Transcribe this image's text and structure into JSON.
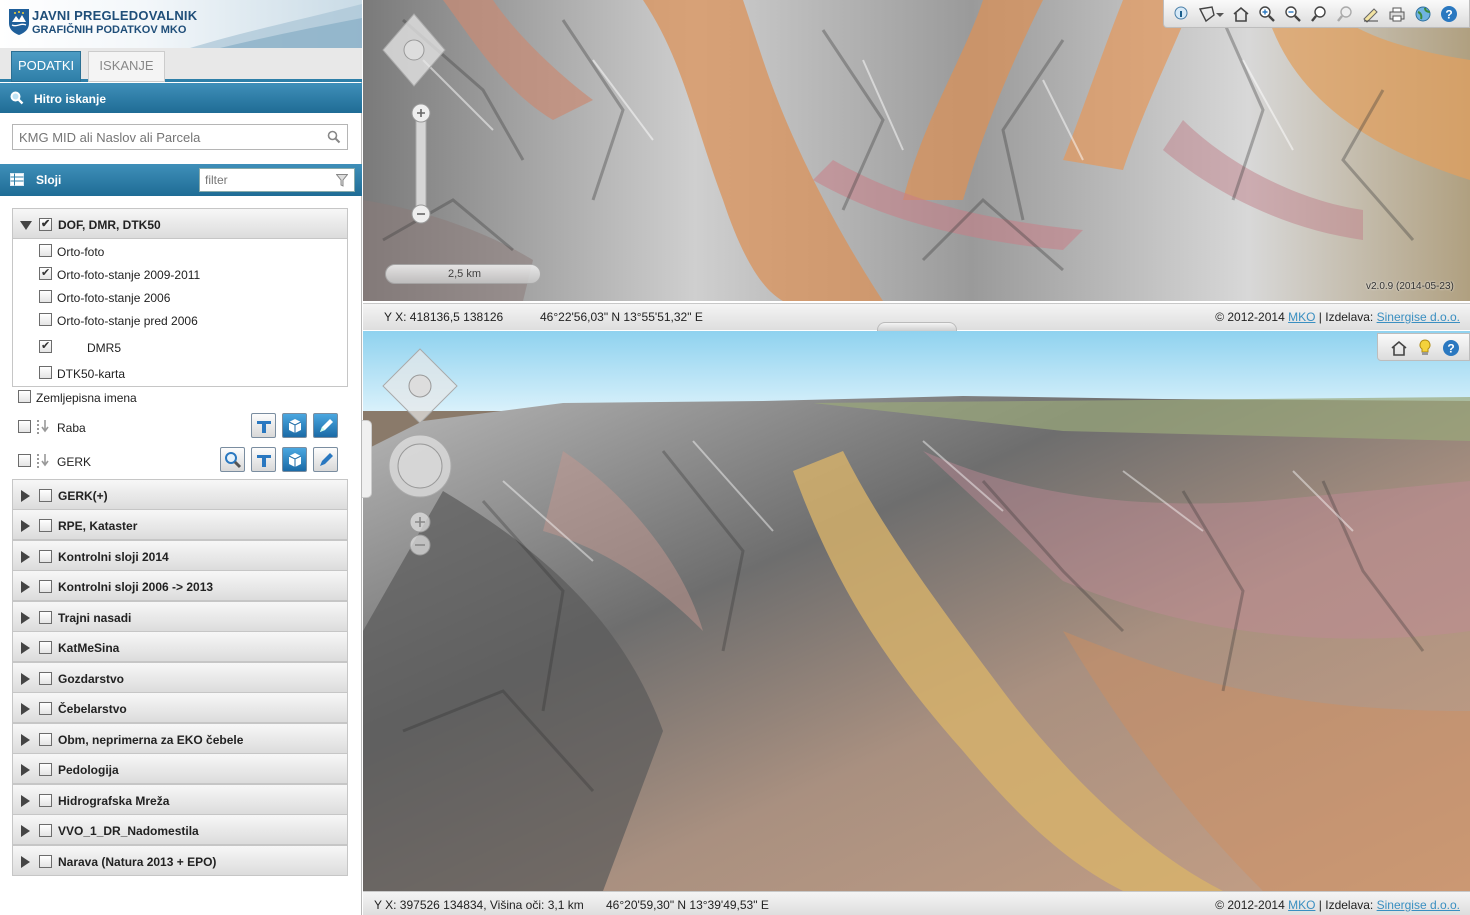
{
  "app": {
    "title_line1": "JAVNI PREGLEDOVALNIK",
    "title_line2": "GRAFIČNIH PODATKOV MKO"
  },
  "tabs": [
    {
      "label": "PODATKI",
      "active": true
    },
    {
      "label": "ISKANJE",
      "active": false
    }
  ],
  "quick_search": {
    "header": "Hitro iskanje",
    "placeholder": "KMG MID ali Naslov ali Parcela"
  },
  "layers": {
    "header": "Sloji",
    "filter_placeholder": "filter",
    "dof_group": {
      "label": "DOF, DMR, DTK50",
      "checked": true,
      "expanded": true,
      "items": [
        {
          "label": "Orto-foto",
          "checked": false
        },
        {
          "label": "Orto-foto-stanje 2009-2011",
          "checked": true
        },
        {
          "label": "Orto-foto-stanje 2006",
          "checked": false
        },
        {
          "label": "Orto-foto-stanje pred 2006",
          "checked": false
        },
        {
          "label": "DMR5",
          "checked": true
        },
        {
          "label": "DTK50-karta",
          "checked": false
        }
      ]
    },
    "standalone": [
      {
        "label": "Zemljepisna imena",
        "checked": false
      },
      {
        "label": "Raba",
        "checked": false
      },
      {
        "label": "GERK",
        "checked": false
      }
    ],
    "groups": [
      {
        "label": "GERK(+)"
      },
      {
        "label": "RPE, Kataster"
      },
      {
        "label": "Kontrolni sloji 2014"
      },
      {
        "label": "Kontrolni sloji 2006 -> 2013"
      },
      {
        "label": "Trajni nasadi"
      },
      {
        "label": "KatMeSina"
      },
      {
        "label": "Gozdarstvo"
      },
      {
        "label": "Čebelarstvo"
      },
      {
        "label": "Obm, neprimerna za EKO čebele"
      },
      {
        "label": "Pedologija"
      },
      {
        "label": "Hidrografska Mreža"
      },
      {
        "label": "VVO_1_DR_Nadomestila"
      },
      {
        "label": "Narava (Natura 2013 + EPO)"
      }
    ]
  },
  "map2d": {
    "scale": "2,5 km",
    "version": "v2.0.9 (2014-05-23)",
    "coords": "Y X: 418136,5 138126",
    "geo": "46°22'56,03\" N 13°55'51,32\" E"
  },
  "map3d": {
    "coords": "Y X: 397526 134834, Višina oči: 3,1 km",
    "geo": "46°20'59,30\" N 13°39'49,53\" E"
  },
  "footer": {
    "copyright": "© 2012-2014",
    "mko_link": "MKO",
    "izdelava": "| Izdelava:",
    "sinergise_link": "Sinergise d.o.o."
  },
  "icons": {
    "search": "search-icon",
    "filter": "filter-icon",
    "layers": "layers-icon",
    "home": "home-icon",
    "help": "help-icon"
  }
}
